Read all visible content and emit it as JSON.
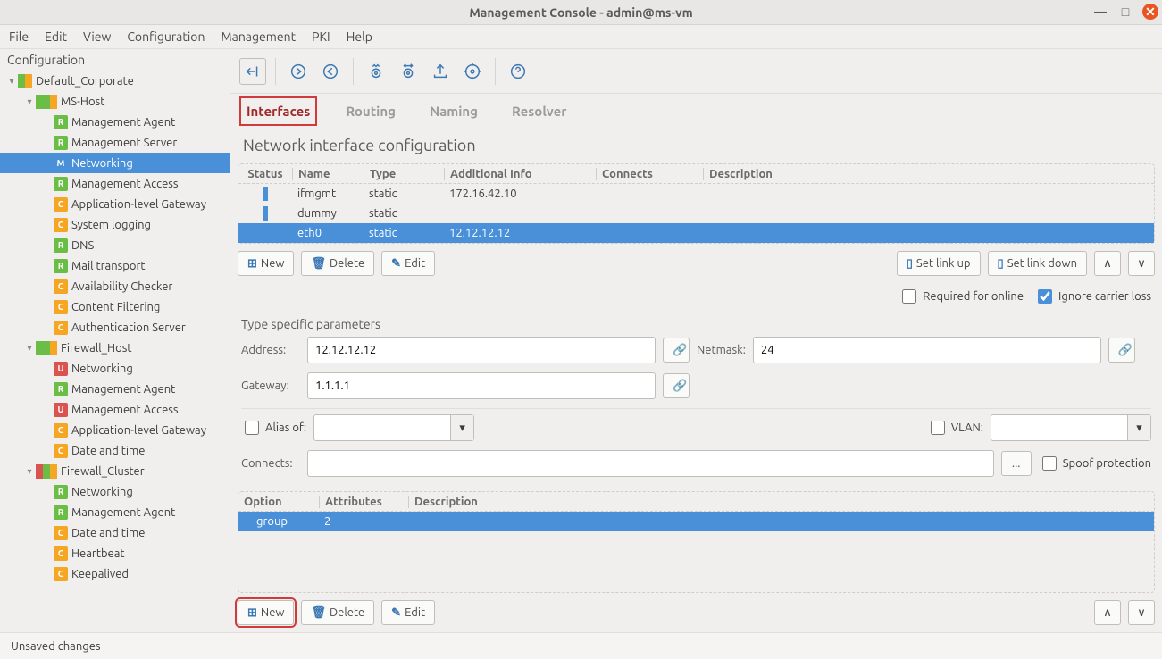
{
  "window": {
    "title": "Management Console - admin@ms-vm"
  },
  "menubar": [
    "File",
    "Edit",
    "View",
    "Configuration",
    "Management",
    "PKI",
    "Help"
  ],
  "sidebar": {
    "title": "Configuration",
    "tree": [
      {
        "depth": 0,
        "caret": "▾",
        "badges": [
          "green",
          "orange"
        ],
        "label": "Default_Corporate"
      },
      {
        "depth": 1,
        "caret": "▾",
        "badges": [
          "green",
          "green",
          "orange"
        ],
        "label": "MS-Host"
      },
      {
        "depth": 2,
        "icon": "R",
        "iconColor": "green",
        "label": "Management Agent"
      },
      {
        "depth": 2,
        "icon": "R",
        "iconColor": "green",
        "label": "Management Server"
      },
      {
        "depth": 2,
        "icon": "M",
        "iconColor": "blue",
        "label": "Networking",
        "selected": true
      },
      {
        "depth": 2,
        "icon": "R",
        "iconColor": "green",
        "label": "Management Access"
      },
      {
        "depth": 2,
        "icon": "C",
        "iconColor": "orange",
        "label": "Application-level Gateway"
      },
      {
        "depth": 2,
        "icon": "C",
        "iconColor": "orange",
        "label": "System logging"
      },
      {
        "depth": 2,
        "icon": "R",
        "iconColor": "green",
        "label": "DNS"
      },
      {
        "depth": 2,
        "icon": "R",
        "iconColor": "green",
        "label": "Mail transport"
      },
      {
        "depth": 2,
        "icon": "C",
        "iconColor": "orange",
        "label": "Availability Checker"
      },
      {
        "depth": 2,
        "icon": "C",
        "iconColor": "orange",
        "label": "Content Filtering"
      },
      {
        "depth": 2,
        "icon": "C",
        "iconColor": "orange",
        "label": "Authentication Server"
      },
      {
        "depth": 1,
        "caret": "▾",
        "badges": [
          "green",
          "green",
          "orange"
        ],
        "label": "Firewall_Host"
      },
      {
        "depth": 2,
        "icon": "U",
        "iconColor": "red",
        "label": "Networking"
      },
      {
        "depth": 2,
        "icon": "R",
        "iconColor": "green",
        "label": "Management Agent"
      },
      {
        "depth": 2,
        "icon": "U",
        "iconColor": "red",
        "label": "Management Access"
      },
      {
        "depth": 2,
        "icon": "C",
        "iconColor": "orange",
        "label": "Application-level Gateway"
      },
      {
        "depth": 2,
        "icon": "C",
        "iconColor": "orange",
        "label": "Date and time"
      },
      {
        "depth": 1,
        "caret": "▾",
        "badges": [
          "red",
          "green",
          "orange"
        ],
        "label": "Firewall_Cluster"
      },
      {
        "depth": 2,
        "icon": "R",
        "iconColor": "green",
        "label": "Networking"
      },
      {
        "depth": 2,
        "icon": "R",
        "iconColor": "green",
        "label": "Management Agent"
      },
      {
        "depth": 2,
        "icon": "C",
        "iconColor": "orange",
        "label": "Date and time"
      },
      {
        "depth": 2,
        "icon": "C",
        "iconColor": "orange",
        "label": "Heartbeat"
      },
      {
        "depth": 2,
        "icon": "C",
        "iconColor": "orange",
        "label": "Keepalived"
      }
    ]
  },
  "tabs": {
    "items": [
      "Interfaces",
      "Routing",
      "Naming",
      "Resolver"
    ],
    "active": 0
  },
  "page": {
    "title": "Network interface configuration"
  },
  "if_table": {
    "headers": [
      "Status",
      "Name",
      "Type",
      "Additional Info",
      "Connects",
      "Description"
    ],
    "rows": [
      {
        "name": "ifmgmt",
        "type": "static",
        "info": "172.16.42.10"
      },
      {
        "name": "dummy",
        "type": "static",
        "info": ""
      },
      {
        "name": "eth0",
        "type": "static",
        "info": "12.12.12.12",
        "selected": true
      }
    ]
  },
  "buttons": {
    "new": "New",
    "delete": "Delete",
    "edit": "Edit",
    "linkup": "Set link up",
    "linkdown": "Set link down",
    "required": "Required for online",
    "ignore": "Ignore carrier loss",
    "ellipsis": "..."
  },
  "params": {
    "title": "Type specific parameters",
    "address_lbl": "Address:",
    "address": "12.12.12.12",
    "netmask_lbl": "Netmask:",
    "netmask": "24",
    "gateway_lbl": "Gateway:",
    "gateway": "1.1.1.1",
    "alias_lbl": "Alias of:",
    "vlan_lbl": "VLAN:",
    "connects_lbl": "Connects:",
    "spoof_lbl": "Spoof protection"
  },
  "opt_table": {
    "headers": [
      "Option",
      "Attributes",
      "Description"
    ],
    "rows": [
      {
        "option": "group",
        "attrs": "2",
        "desc": ""
      }
    ]
  },
  "statusbar": "Unsaved changes"
}
